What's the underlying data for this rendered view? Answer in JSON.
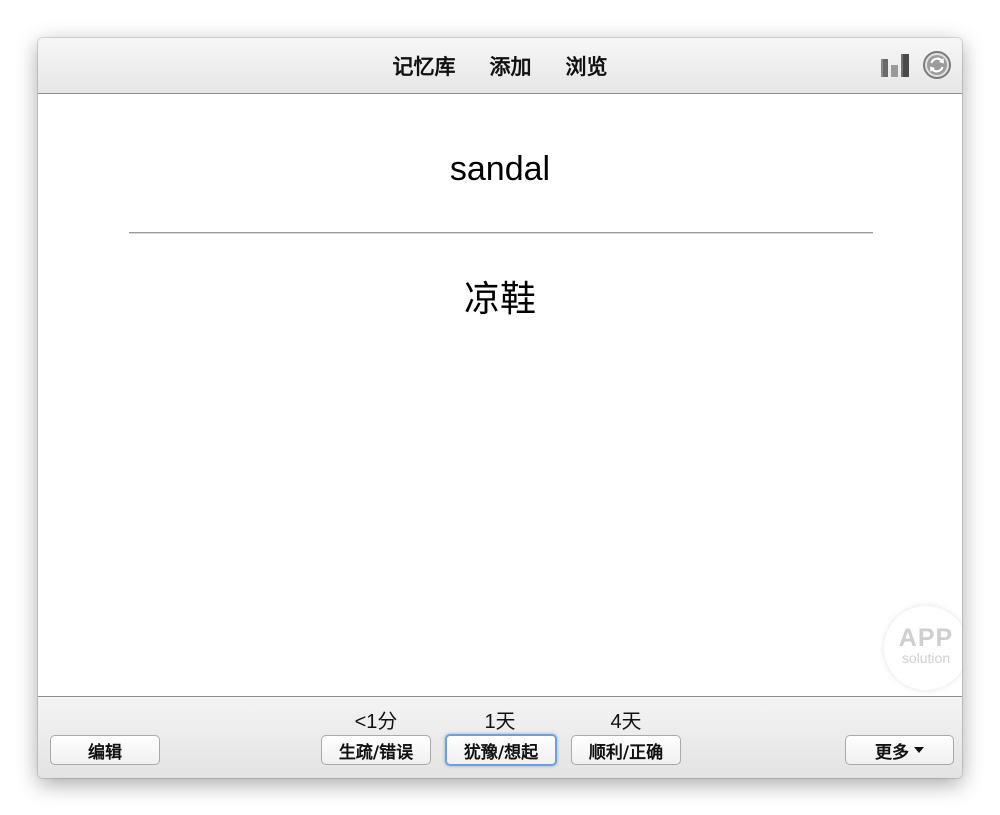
{
  "header": {
    "nav": {
      "decks": "记忆库",
      "add": "添加",
      "browse": "浏览"
    },
    "icons": [
      "stats-icon",
      "sync-icon"
    ]
  },
  "card": {
    "question": "sandal",
    "answer": "凉鞋"
  },
  "watermark": {
    "line1": "APP",
    "line2": "solution"
  },
  "footer": {
    "edit_label": "编辑",
    "more_label": "更多",
    "answers": [
      {
        "interval": "<1分",
        "label": "生疏/错误"
      },
      {
        "interval": "1天",
        "label": "犹豫/想起"
      },
      {
        "interval": "4天",
        "label": "顺利/正确"
      }
    ]
  },
  "colors": {
    "focus_ring": "#6ea0dc",
    "divider": "#9a9a9a"
  }
}
